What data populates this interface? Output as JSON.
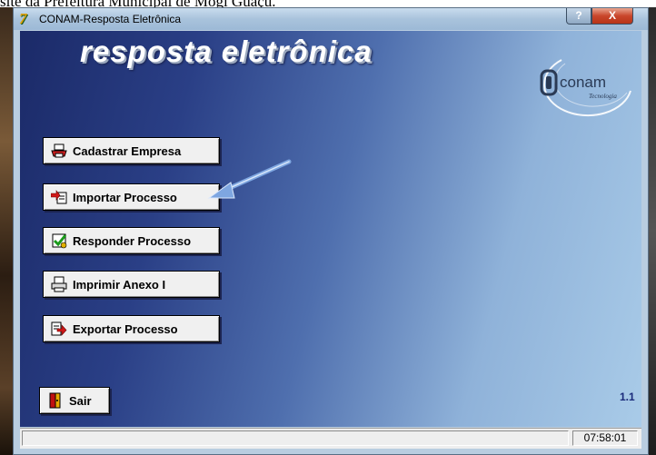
{
  "caption": "site da Prefeitura Municipal de Mogi Guaçu.",
  "window": {
    "title": "CONAM-Resposta Eletrônica",
    "app_icon_glyph": "7",
    "help_glyph": "?",
    "close_glyph": "X"
  },
  "brand": {
    "title": "resposta eletrônica",
    "logo_name": "conam",
    "logo_tagline": "Tecnologia"
  },
  "buttons": {
    "cadastrar": "Cadastrar Empresa",
    "importar": "Importar Processo",
    "responder": "Responder Processo",
    "imprimir": "Imprimir Anexo I",
    "exportar": "Exportar Processo",
    "sair": "Sair"
  },
  "version": "1.1",
  "status": {
    "left": "",
    "time": "07:58:01"
  },
  "colors": {
    "client_dark": "#1b2a68",
    "client_light": "#a9cbe8",
    "annotation_arrow": "#7ea6e0"
  }
}
